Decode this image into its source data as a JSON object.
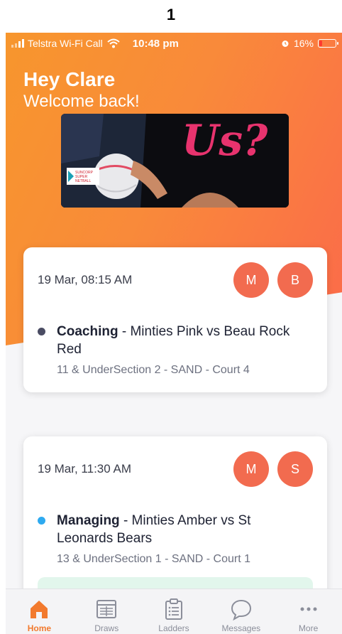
{
  "page_label": "1",
  "status_bar": {
    "carrier": "Telstra Wi-Fi Call",
    "time": "10:48 pm",
    "battery": "16%"
  },
  "greeting": {
    "title": "Hey Clare",
    "subtitle": "Welcome back!"
  },
  "banner": {
    "headline": "Us?",
    "logo_text": [
      "SUNCORP",
      "SUPER",
      "NETBALL"
    ]
  },
  "events": [
    {
      "date": "19 Mar, 08:15 AM",
      "avatars": [
        "M",
        "B"
      ],
      "role": "Coaching",
      "matchup": " - Minties Pink vs Beau Rock Red",
      "details": "11 & UnderSection 2 - SAND - Court 4",
      "dot_color": "#4a4c63"
    },
    {
      "date": "19 Mar, 11:30 AM",
      "avatars": [
        "M",
        "S"
      ],
      "role": "Managing",
      "matchup": " - Minties Amber vs St Leonards Bears",
      "details": "13 & UnderSection 1 - SAND - Court 1",
      "dot_color": "#2eaaf0"
    }
  ],
  "tabs": [
    {
      "label": "Home",
      "icon": "home-icon",
      "active": true
    },
    {
      "label": "Draws",
      "icon": "draws-icon",
      "active": false
    },
    {
      "label": "Ladders",
      "icon": "ladders-icon",
      "active": false
    },
    {
      "label": "Messages",
      "icon": "messages-icon",
      "active": false
    },
    {
      "label": "More",
      "icon": "more-icon",
      "active": false
    }
  ],
  "colors": {
    "gradient_start": "#f7962d",
    "gradient_end": "#fb6a4a",
    "avatar": "#f26b4f",
    "active_tab": "#f27a2e",
    "pink_headline": "#e8336e"
  }
}
